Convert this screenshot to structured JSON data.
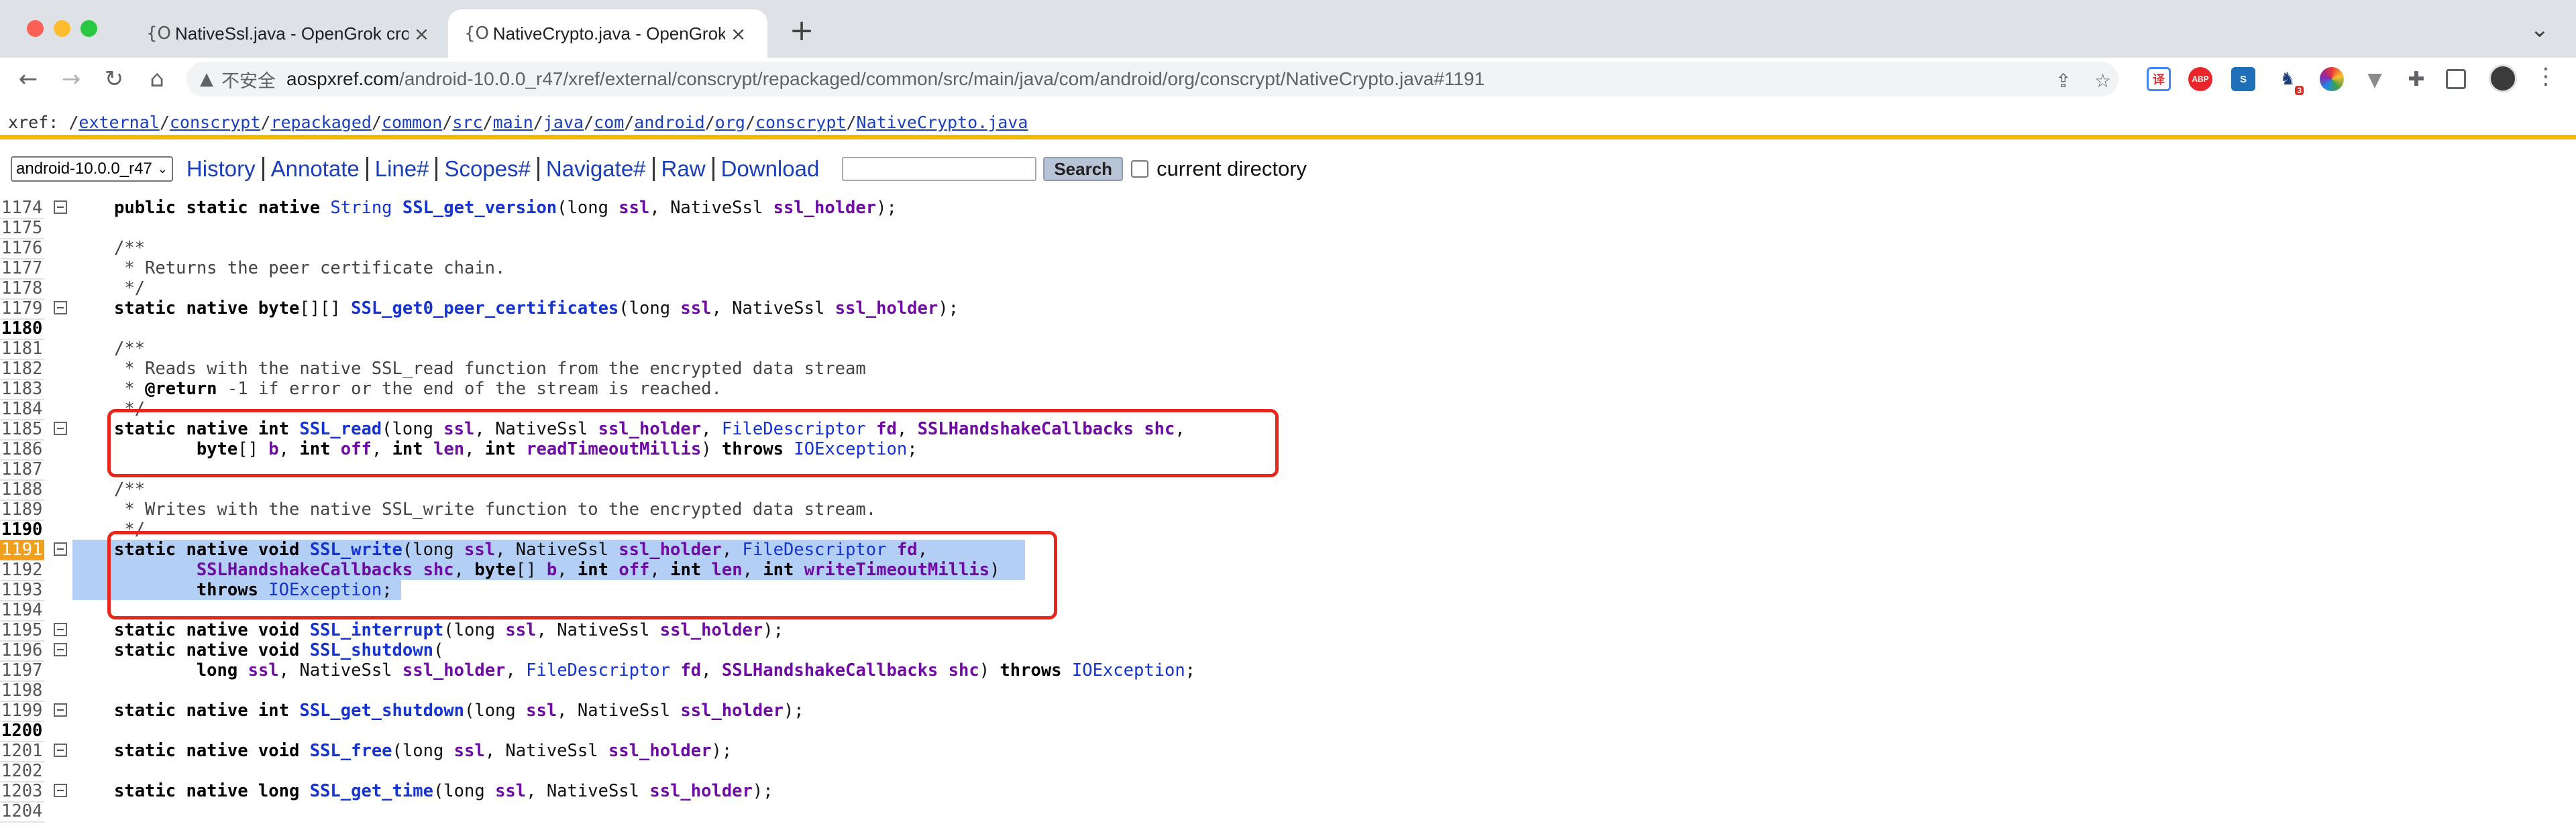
{
  "browser": {
    "tabs": [
      {
        "favicon": "{O",
        "title": "NativeSsl.java - OpenGrok cross",
        "active": false
      },
      {
        "favicon": "{O",
        "title": "NativeCrypto.java - OpenGrok",
        "active": true
      }
    ],
    "new_tab": "+",
    "tab_menu": "⌄",
    "insecure_label": "不安全",
    "url_host": "aospxref.com",
    "url_path": "/android-10.0.0_r47/xref/external/conscrypt/repackaged/common/src/main/java/com/android/org/conscrypt/NativeCrypto.java#1191",
    "extensions": [
      {
        "name": "translate-icon",
        "bg": "#ffffff",
        "text": "",
        "color": "#4285f4"
      },
      {
        "name": "adblock-icon",
        "bg": "#e8262b",
        "text": "ABP",
        "color": "#ffffff"
      },
      {
        "name": "s-extension-icon",
        "bg": "#1e6fb8",
        "text": "S",
        "color": "#ffffff"
      },
      {
        "name": "badge-extension-icon",
        "bg": "#ffffff",
        "text": "3",
        "color": "#d33"
      },
      {
        "name": "color-extension-icon",
        "bg": "#ffffff",
        "text": "",
        "color": "#444"
      },
      {
        "name": "vee-extension-icon",
        "bg": "#ffffff",
        "text": "",
        "color": "#888"
      }
    ]
  },
  "xref": {
    "label": "xref:",
    "path": [
      "external",
      "conscrypt",
      "repackaged",
      "common",
      "src",
      "main",
      "java",
      "com",
      "android",
      "org",
      "conscrypt",
      "NativeCrypto.java"
    ]
  },
  "menu": {
    "version": "android-10.0.0_r47",
    "links": [
      "History",
      "Annotate",
      "Line#",
      "Scopes#",
      "Navigate#",
      "Raw",
      "Download"
    ],
    "search_button": "Search",
    "current_dir": "current directory"
  },
  "code": {
    "current_line": 1191,
    "lines": [
      {
        "n": "1174",
        "fold": true,
        "tokens": [
          [
            "kw",
            "public static native "
          ],
          [
            "tp",
            "String "
          ],
          [
            "fn",
            "SSL_get_version"
          ],
          [
            "",
            "(long "
          ],
          [
            "vr",
            "ssl"
          ],
          [
            "",
            ", NativeSsl "
          ],
          [
            "vr",
            "ssl_holder"
          ],
          [
            "",
            ");"
          ]
        ]
      },
      {
        "n": "1175",
        "tokens": []
      },
      {
        "n": "1176",
        "tokens": [
          [
            "cm",
            "/**"
          ]
        ]
      },
      {
        "n": "1177",
        "tokens": [
          [
            "cm",
            " * Returns the peer certificate chain."
          ]
        ]
      },
      {
        "n": "1178",
        "tokens": [
          [
            "cm",
            " */"
          ]
        ]
      },
      {
        "n": "1179",
        "fold": true,
        "tokens": [
          [
            "kw",
            "static native byte"
          ],
          [
            "",
            "[][] "
          ],
          [
            "fn",
            "SSL_get0_peer_certificates"
          ],
          [
            "",
            "(long "
          ],
          [
            "vr",
            "ssl"
          ],
          [
            "",
            ", NativeSsl "
          ],
          [
            "vr",
            "ssl_holder"
          ],
          [
            "",
            ");"
          ]
        ]
      },
      {
        "n": "1180",
        "bold": true,
        "tokens": []
      },
      {
        "n": "1181",
        "tokens": [
          [
            "cm",
            "/**"
          ]
        ]
      },
      {
        "n": "1182",
        "tokens": [
          [
            "cm",
            " * Reads with the native SSL_read function from the encrypted data stream"
          ]
        ]
      },
      {
        "n": "1183",
        "tokens": [
          [
            "cm",
            " * "
          ],
          [
            "kw",
            "@return"
          ],
          [
            "cm",
            " -1 if error or the end of the stream is reached."
          ]
        ]
      },
      {
        "n": "1184",
        "tokens": [
          [
            "cm",
            " */"
          ]
        ]
      },
      {
        "n": "1185",
        "fold": true,
        "tokens": [
          [
            "kw",
            "static native int "
          ],
          [
            "fn",
            "SSL_read"
          ],
          [
            "",
            "(long "
          ],
          [
            "vr",
            "ssl"
          ],
          [
            "",
            ", NativeSsl "
          ],
          [
            "vr",
            "ssl_holder"
          ],
          [
            "",
            ", "
          ],
          [
            "tp",
            "FileDescriptor "
          ],
          [
            "vr",
            "fd"
          ],
          [
            "",
            ", "
          ],
          [
            "vr",
            "SSLHandshakeCallbacks shc"
          ],
          [
            "",
            ","
          ]
        ]
      },
      {
        "n": "1186",
        "tokens": [
          [
            "kw",
            "        byte"
          ],
          [
            "",
            "[] "
          ],
          [
            "vr",
            "b"
          ],
          [
            "",
            ", "
          ],
          [
            "kw",
            "int "
          ],
          [
            "vr",
            "off"
          ],
          [
            "",
            ", "
          ],
          [
            "kw",
            "int "
          ],
          [
            "vr",
            "len"
          ],
          [
            "",
            ", "
          ],
          [
            "kw",
            "int "
          ],
          [
            "vr",
            "readTimeoutMillis"
          ],
          [
            "",
            ") "
          ],
          [
            "kw",
            "throws "
          ],
          [
            "tp",
            "IOException"
          ],
          [
            "",
            ";"
          ]
        ]
      },
      {
        "n": "1187",
        "tokens": []
      },
      {
        "n": "1188",
        "tokens": [
          [
            "cm",
            "/**"
          ]
        ]
      },
      {
        "n": "1189",
        "tokens": [
          [
            "cm",
            " * Writes with the native SSL_write function to the encrypted data stream."
          ]
        ]
      },
      {
        "n": "1190",
        "bold": true,
        "tokens": [
          [
            "cm",
            " */"
          ]
        ]
      },
      {
        "n": "1191",
        "fold": true,
        "current": true,
        "hl": true,
        "tokens": [
          [
            "kw",
            "static native void "
          ],
          [
            "fn",
            "SSL_write"
          ],
          [
            "",
            "(long "
          ],
          [
            "vr",
            "ssl"
          ],
          [
            "",
            ", NativeSsl "
          ],
          [
            "vr",
            "ssl_holder"
          ],
          [
            "",
            ", "
          ],
          [
            "tp",
            "FileDescriptor "
          ],
          [
            "vr",
            "fd"
          ],
          [
            "",
            ","
          ]
        ]
      },
      {
        "n": "1192",
        "hl": true,
        "tokens": [
          [
            "vr",
            "        SSLHandshakeCallbacks "
          ],
          [
            "vr",
            "shc"
          ],
          [
            "",
            ", "
          ],
          [
            "kw",
            "byte"
          ],
          [
            "",
            "[] "
          ],
          [
            "vr",
            "b"
          ],
          [
            "",
            ", "
          ],
          [
            "kw",
            "int "
          ],
          [
            "vr",
            "off"
          ],
          [
            "",
            ", "
          ],
          [
            "kw",
            "int "
          ],
          [
            "vr",
            "len"
          ],
          [
            "",
            ", "
          ],
          [
            "kw",
            "int "
          ],
          [
            "vr",
            "writeTimeoutMillis"
          ],
          [
            "",
            ")"
          ]
        ]
      },
      {
        "n": "1193",
        "hl": true,
        "tokens": [
          [
            "kw",
            "        throws "
          ],
          [
            "tp",
            "IOException"
          ],
          [
            "",
            ";"
          ]
        ]
      },
      {
        "n": "1194",
        "tokens": []
      },
      {
        "n": "1195",
        "fold": true,
        "tokens": [
          [
            "kw",
            "static native void "
          ],
          [
            "fn",
            "SSL_interrupt"
          ],
          [
            "",
            "(long "
          ],
          [
            "vr",
            "ssl"
          ],
          [
            "",
            ", NativeSsl "
          ],
          [
            "vr",
            "ssl_holder"
          ],
          [
            "",
            ");"
          ]
        ]
      },
      {
        "n": "1196",
        "fold": true,
        "tokens": [
          [
            "kw",
            "static native void "
          ],
          [
            "fn",
            "SSL_shutdown"
          ],
          [
            "",
            "("
          ]
        ]
      },
      {
        "n": "1197",
        "tokens": [
          [
            "kw",
            "        long "
          ],
          [
            "vr",
            "ssl"
          ],
          [
            "",
            ", NativeSsl "
          ],
          [
            "vr",
            "ssl_holder"
          ],
          [
            "",
            ", "
          ],
          [
            "tp",
            "FileDescriptor "
          ],
          [
            "vr",
            "fd"
          ],
          [
            "",
            ", "
          ],
          [
            "vr",
            "SSLHandshakeCallbacks shc"
          ],
          [
            "",
            ") "
          ],
          [
            "kw",
            "throws "
          ],
          [
            "tp",
            "IOException"
          ],
          [
            "",
            ";"
          ]
        ]
      },
      {
        "n": "1198",
        "tokens": []
      },
      {
        "n": "1199",
        "fold": true,
        "tokens": [
          [
            "kw",
            "static native int "
          ],
          [
            "fn",
            "SSL_get_shutdown"
          ],
          [
            "",
            "(long "
          ],
          [
            "vr",
            "ssl"
          ],
          [
            "",
            ", NativeSsl "
          ],
          [
            "vr",
            "ssl_holder"
          ],
          [
            "",
            ");"
          ]
        ]
      },
      {
        "n": "1200",
        "bold": true,
        "tokens": []
      },
      {
        "n": "1201",
        "fold": true,
        "tokens": [
          [
            "kw",
            "static native void "
          ],
          [
            "fn",
            "SSL_free"
          ],
          [
            "",
            "(long "
          ],
          [
            "vr",
            "ssl"
          ],
          [
            "",
            ", NativeSsl "
          ],
          [
            "vr",
            "ssl_holder"
          ],
          [
            "",
            ");"
          ]
        ]
      },
      {
        "n": "1202",
        "tokens": []
      },
      {
        "n": "1203",
        "fold": true,
        "tokens": [
          [
            "kw",
            "static native long "
          ],
          [
            "fn",
            "SSL_get_time"
          ],
          [
            "",
            "(long "
          ],
          [
            "vr",
            "ssl"
          ],
          [
            "",
            ", NativeSsl "
          ],
          [
            "vr",
            "ssl_holder"
          ],
          [
            "",
            ");"
          ]
        ]
      },
      {
        "n": "1204",
        "tokens": []
      }
    ]
  }
}
